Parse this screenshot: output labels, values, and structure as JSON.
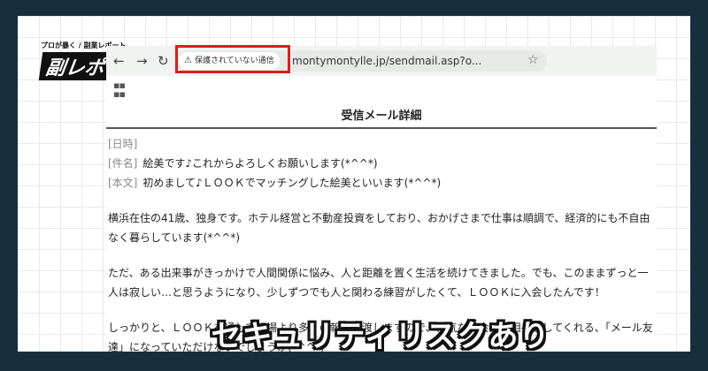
{
  "logo": {
    "tagline": "プロが暴く / 副業レポート",
    "mark": "副レポ"
  },
  "browser": {
    "security_label": "保護されていない通信",
    "url": "montymontylle.jp/sendmail.asp?o..."
  },
  "page": {
    "title": "受信メール詳細"
  },
  "mail": {
    "date_label": "[日時]",
    "subject_label": "[件名]",
    "subject": "絵美です♪これからよろしくお願いします(*^^*)",
    "body_label": "[本文]",
    "body_first": "初めまして♪ＬＯＯＫでマッチングした絵美といいます(*^^*)",
    "paragraph_1": "横浜在住の41歳、独身です。ホテル経営と不動産投資をしており、おかげさまで仕事は順調で、経済的にも不自由なく暮らしています(*^^*)",
    "paragraph_2": "ただ、ある出来事がきっかけで人間関係に悩み、人と距離を置く生活を続けてきました。でも、このままずっと一人は寂しい…と思うようになり、少しずつでも人と関わる練習がしたくて、ＬＯＯＫに入会したんです！",
    "paragraph_3": "しっかりと、ＬＯＯＫを通して相場より多くの報酬を渡しますので、何気ない会話の相手をしてくれる、「メール友達」になっていただけないでしょうか(*^^*)"
  },
  "caption": "セキュリティリスクあり",
  "colors": {
    "background": "#162f3f",
    "highlight": "#e11b1b"
  }
}
